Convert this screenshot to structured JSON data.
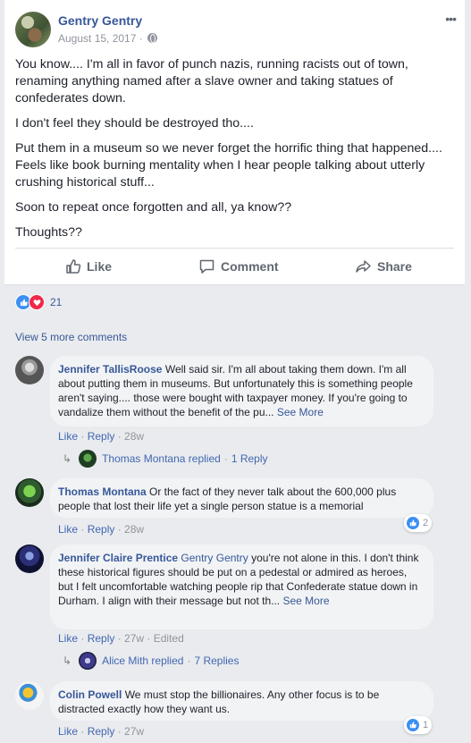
{
  "post": {
    "author": "Gentry Gentry",
    "date": "August 15, 2017 ·",
    "more": "•••",
    "paragraphs": [
      "You know.... I'm all in favor of punch nazis, running racists out of town, renaming anything named after a slave owner and taking statues of confederates down.",
      "I don't feel they should be destroyed tho....",
      "Put them in a museum so we never forget the horrific thing that happened.... Feels like book burning mentality when I hear people talking about utterly crushing historical stuff...",
      "Soon to repeat once forgotten and all, ya know??",
      "Thoughts??"
    ],
    "actions": {
      "like": "Like",
      "comment": "Comment",
      "share": "Share"
    },
    "reaction_count": "21",
    "colors": {
      "link": "#365899",
      "like": "#3b8ff3",
      "love": "#f0284a"
    }
  },
  "comments_section": {
    "view_more": "View 5 more comments",
    "like_label": "Like",
    "reply_label": "Reply",
    "comments": [
      {
        "name": "Jennifer TallisRoose",
        "text": "Well said sir. I'm all about taking them down. I'm all about putting them in museums. But unfortunately this is something people aren't saying.... those were bought with taxpayer money. If you're going to vandalize them without the benefit of the pu...",
        "see_more": "See More",
        "time": "28w",
        "replies": {
          "who": "Thomas Montana replied",
          "count": "1 Reply"
        }
      },
      {
        "name": "Thomas Montana",
        "text": "Or the fact of they never talk about the 600,000 plus people that lost their life yet a single person statue is a memorial",
        "time": "28w",
        "reaction_count": "2"
      },
      {
        "name": "Jennifer Claire Prentice",
        "tag": "Gentry Gentry",
        "text": "you're not alone in this. I don't think these historical figures should be put on a pedestal or admired as heroes, but I felt uncomfortable watching people rip that Confederate statue down in Durham. I align with their message but not th...",
        "see_more": "See More",
        "time": "27w",
        "edited": "Edited",
        "replies": {
          "who": "Alice Mith replied",
          "count": "7 Replies"
        }
      },
      {
        "name": "Colin Powell",
        "text": "We must stop the billionaires. Any other focus is to be distracted exactly how they want us.",
        "time": "27w",
        "reaction_count": "1"
      }
    ]
  }
}
